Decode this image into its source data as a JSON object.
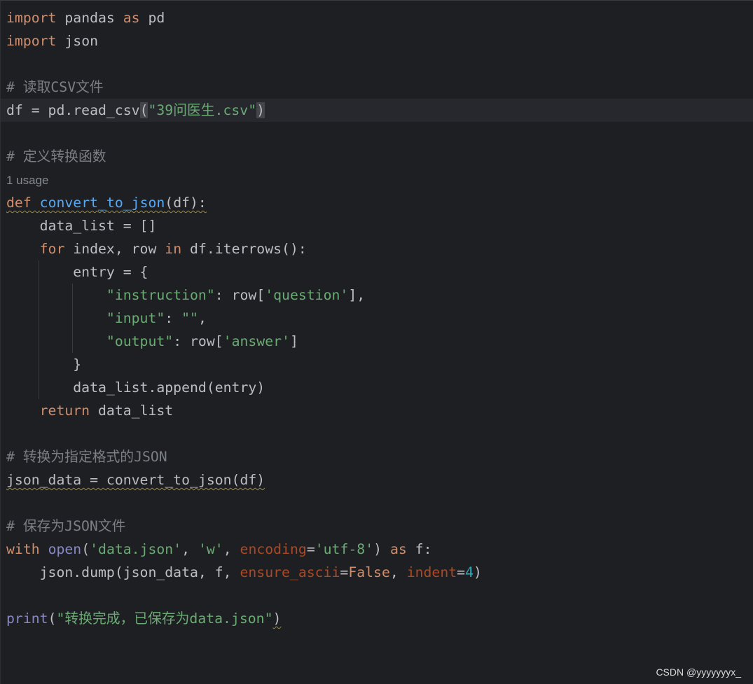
{
  "editor": {
    "lines": [
      {
        "id": "l1",
        "tokens": [
          {
            "t": "import",
            "c": "kw"
          },
          {
            "t": " pandas ",
            "c": ""
          },
          {
            "t": "as",
            "c": "kw"
          },
          {
            "t": " pd",
            "c": ""
          }
        ]
      },
      {
        "id": "l2",
        "tokens": [
          {
            "t": "import",
            "c": "kw"
          },
          {
            "t": " json",
            "c": ""
          }
        ]
      },
      {
        "id": "l3",
        "tokens": []
      },
      {
        "id": "l4",
        "tokens": [
          {
            "t": "# 读取CSV文件",
            "c": "cm"
          }
        ]
      },
      {
        "id": "l5",
        "current": true,
        "tokens": [
          {
            "t": "df = pd.read_csv",
            "c": ""
          },
          {
            "t": "(",
            "c": "bracket-hl"
          },
          {
            "t": "\"39问医生.csv\"",
            "c": "str"
          },
          {
            "t": ")",
            "c": "bracket-hl"
          }
        ]
      },
      {
        "id": "l6",
        "tokens": []
      },
      {
        "id": "l7",
        "tokens": [
          {
            "t": "# 定义转换函数",
            "c": "cm"
          }
        ]
      },
      {
        "id": "l8",
        "usage": true,
        "tokens": [
          {
            "t": "1 usage",
            "c": "usage"
          }
        ]
      },
      {
        "id": "l9",
        "tokens": [
          {
            "t": "def",
            "c": "kw warn"
          },
          {
            "t": " ",
            "c": "warn"
          },
          {
            "t": "convert_to_json",
            "c": "fn warn"
          },
          {
            "t": "(df):",
            "c": "warn"
          }
        ]
      },
      {
        "id": "l10",
        "tokens": [
          {
            "t": "    data_list = []",
            "c": ""
          }
        ]
      },
      {
        "id": "l11",
        "tokens": [
          {
            "t": "    ",
            "c": ""
          },
          {
            "t": "for",
            "c": "kw"
          },
          {
            "t": " index, row ",
            "c": ""
          },
          {
            "t": "in",
            "c": "kw"
          },
          {
            "t": " df.iterrows():",
            "c": ""
          }
        ]
      },
      {
        "id": "l12",
        "tokens": [
          {
            "t": "        entry = {",
            "c": ""
          }
        ]
      },
      {
        "id": "l13",
        "tokens": [
          {
            "t": "            ",
            "c": ""
          },
          {
            "t": "\"instruction\"",
            "c": "str"
          },
          {
            "t": ": row[",
            "c": ""
          },
          {
            "t": "'question'",
            "c": "str"
          },
          {
            "t": "],",
            "c": ""
          }
        ]
      },
      {
        "id": "l14",
        "tokens": [
          {
            "t": "            ",
            "c": ""
          },
          {
            "t": "\"input\"",
            "c": "str"
          },
          {
            "t": ": ",
            "c": ""
          },
          {
            "t": "\"\"",
            "c": "str"
          },
          {
            "t": ",",
            "c": ""
          }
        ]
      },
      {
        "id": "l15",
        "tokens": [
          {
            "t": "            ",
            "c": ""
          },
          {
            "t": "\"output\"",
            "c": "str"
          },
          {
            "t": ": row[",
            "c": ""
          },
          {
            "t": "'answer'",
            "c": "str"
          },
          {
            "t": "]",
            "c": ""
          }
        ]
      },
      {
        "id": "l16",
        "tokens": [
          {
            "t": "        }",
            "c": ""
          }
        ]
      },
      {
        "id": "l17",
        "tokens": [
          {
            "t": "        data_list.append(entry)",
            "c": ""
          }
        ]
      },
      {
        "id": "l18",
        "tokens": [
          {
            "t": "    ",
            "c": ""
          },
          {
            "t": "return",
            "c": "kw"
          },
          {
            "t": " data_list",
            "c": ""
          }
        ]
      },
      {
        "id": "l19",
        "tokens": []
      },
      {
        "id": "l20",
        "tokens": [
          {
            "t": "# 转换为指定格式的JSON",
            "c": "cm"
          }
        ]
      },
      {
        "id": "l21",
        "tokens": [
          {
            "t": "json_data = convert_to_json(df)",
            "c": "warn"
          }
        ]
      },
      {
        "id": "l22",
        "tokens": []
      },
      {
        "id": "l23",
        "tokens": [
          {
            "t": "# 保存为JSON文件",
            "c": "cm"
          }
        ]
      },
      {
        "id": "l24",
        "tokens": [
          {
            "t": "with",
            "c": "kw"
          },
          {
            "t": " ",
            "c": ""
          },
          {
            "t": "open",
            "c": "builtin"
          },
          {
            "t": "(",
            "c": ""
          },
          {
            "t": "'data.json'",
            "c": "str"
          },
          {
            "t": ", ",
            "c": ""
          },
          {
            "t": "'w'",
            "c": "str"
          },
          {
            "t": ", ",
            "c": ""
          },
          {
            "t": "encoding",
            "c": "param"
          },
          {
            "t": "=",
            "c": ""
          },
          {
            "t": "'utf-8'",
            "c": "str"
          },
          {
            "t": ") ",
            "c": ""
          },
          {
            "t": "as",
            "c": "kw"
          },
          {
            "t": " f:",
            "c": ""
          }
        ]
      },
      {
        "id": "l25",
        "tokens": [
          {
            "t": "    json.dump(json_data, f, ",
            "c": ""
          },
          {
            "t": "ensure_ascii",
            "c": "param"
          },
          {
            "t": "=",
            "c": ""
          },
          {
            "t": "False",
            "c": "kw"
          },
          {
            "t": ", ",
            "c": ""
          },
          {
            "t": "indent",
            "c": "param"
          },
          {
            "t": "=",
            "c": ""
          },
          {
            "t": "4",
            "c": "num"
          },
          {
            "t": ")",
            "c": ""
          }
        ]
      },
      {
        "id": "l26",
        "tokens": []
      },
      {
        "id": "l27",
        "tokens": [
          {
            "t": "print",
            "c": "builtin"
          },
          {
            "t": "(",
            "c": ""
          },
          {
            "t": "\"转换完成，已保存为data.json\"",
            "c": "str"
          },
          {
            "t": ")",
            "c": "warn"
          }
        ]
      }
    ]
  },
  "watermark": "CSDN @yyyyyyyx_",
  "colors": {
    "background": "#1e1f22",
    "keyword": "#cf8e6d",
    "string": "#6aab73",
    "comment": "#7a7e85",
    "function": "#56a8f5",
    "builtin": "#8888c6",
    "parameter": "#aa4926",
    "number": "#2aacb8"
  }
}
